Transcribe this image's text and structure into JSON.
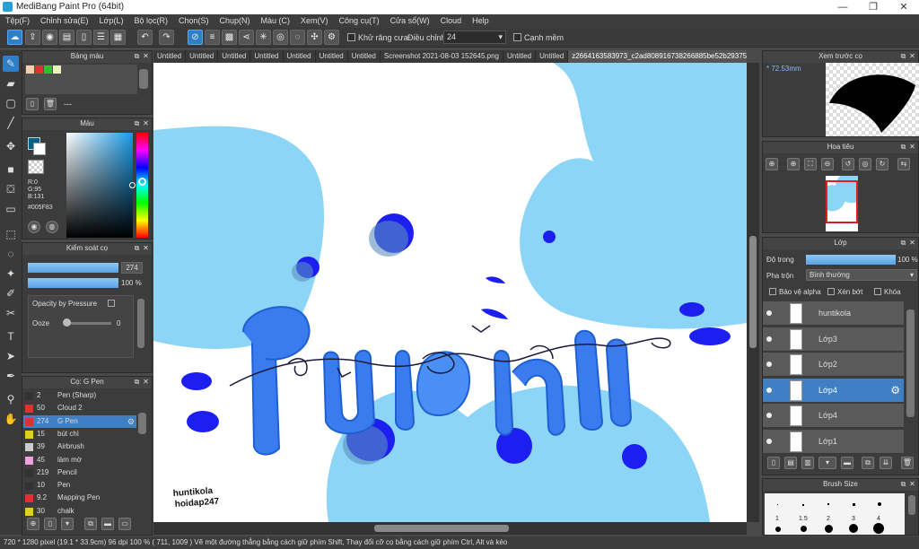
{
  "window": {
    "title": "MediBang Paint Pro (64bit)",
    "controls": [
      "—",
      "❐",
      "✕"
    ]
  },
  "menu": [
    "Tệp(F)",
    "Chỉnh sửa(E)",
    "Lớp(L)",
    "Bộ lọc(R)",
    "Chọn(S)",
    "Chụp(N)",
    "Màu (C)",
    "Xem(V)",
    "Công cụ(T)",
    "Cửa sổ(W)",
    "Cloud",
    "Help"
  ],
  "toolbar": {
    "antialias_label": "Khử răng cưa",
    "adjust_label": "Điều chỉnh",
    "adjust_value": "24",
    "edge_label": "Cạnh mềm"
  },
  "tabs": [
    "Untitled",
    "Untitled",
    "Untitled",
    "Untitled",
    "Untitled",
    "Untitled",
    "Untitled",
    "Screenshot 2021-08-03 152645.png",
    "Untitled",
    "Untitled",
    "z2664163583973_c2ad808916738266885be52b293756c0.jpg"
  ],
  "active_tab_index": 10,
  "palette_panel": {
    "title": "Bảng màu",
    "dash": "---",
    "swatches": [
      "#f5d0b0",
      "#e03030",
      "#30c030",
      "#f0f0c0"
    ]
  },
  "color_panel": {
    "title": "Màu",
    "r": "R:0",
    "g": "G:95",
    "b": "B:131",
    "hex": "#005F83",
    "primary": "#005F83"
  },
  "brush_control": {
    "title": "Kiểm soát cọ",
    "size": "274",
    "opacity": "100 %",
    "pressure_label": "Opacity by Pressure",
    "ooze_label": "Ooze",
    "ooze_value": "0"
  },
  "brush_list": {
    "title": "Cọ: G Pen",
    "items": [
      {
        "n": "2",
        "name": "Pen (Sharp)",
        "color": "#333333"
      },
      {
        "n": "50",
        "name": "Cloud 2",
        "color": "#e03030"
      },
      {
        "n": "274",
        "name": "G Pen",
        "color": "#e03030",
        "selected": true
      },
      {
        "n": "15",
        "name": "bút chì",
        "color": "#e0d020"
      },
      {
        "n": "39",
        "name": "Airbrush",
        "color": "#cccccc"
      },
      {
        "n": "45",
        "name": "làm mờ",
        "color": "#f0a0e0"
      },
      {
        "n": "219",
        "name": "Pencil",
        "color": "#333333"
      },
      {
        "n": "10",
        "name": "Pen",
        "color": "#333333"
      },
      {
        "n": "9.2",
        "name": "Mapping Pen",
        "color": "#e03030"
      },
      {
        "n": "30",
        "name": "chalk",
        "color": "#e0d020"
      }
    ]
  },
  "preview_panel": {
    "title": "Xem trước cọ",
    "size": "72.53mm"
  },
  "navigator_panel": {
    "title": "Hoa tiêu"
  },
  "layer_panel": {
    "title": "Lớp",
    "opacity_label": "Độ trong",
    "opacity_value": "100 %",
    "opacity_fraction": 1.0,
    "blend_label": "Pha trộn",
    "blend_value": "Bình thường",
    "protect_alpha": "Bảo vệ alpha",
    "clipping": "Xén bớt",
    "lock": "Khóa",
    "layers": [
      {
        "name": "huntikola",
        "selected": false
      },
      {
        "name": "Lớp3",
        "selected": false
      },
      {
        "name": "Lớp2",
        "selected": false
      },
      {
        "name": "Lớp4",
        "selected": true
      },
      {
        "name": "Lớp4",
        "selected": false
      },
      {
        "name": "Lớp1",
        "selected": false
      }
    ]
  },
  "brush_size_panel": {
    "title": "Brush Size",
    "labels": [
      "1",
      "1.5",
      "2",
      "3",
      "4"
    ]
  },
  "canvas": {
    "watermark1": "huntikola",
    "watermark2": "hoidap247"
  },
  "status": {
    "text": "720 * 1280 pixel   (19.1 * 33.9cm)   96 dpi   100 %   ( 711, 1009 )   Vẽ một đường thẳng bằng cách giữ phím Shift, Thay đổi cỡ cọ bằng cách giữ phím Ctrl, Alt và kéo"
  }
}
